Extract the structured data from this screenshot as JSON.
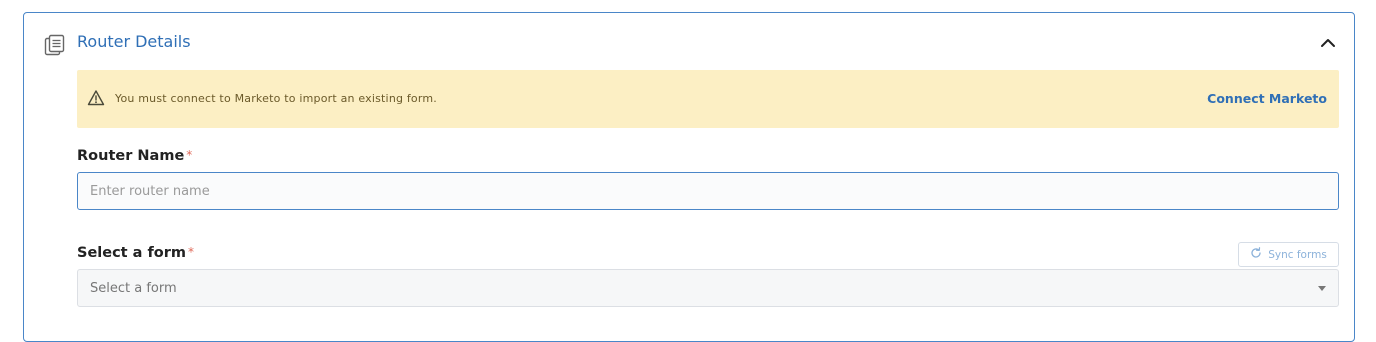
{
  "panel": {
    "title": "Router Details",
    "icon": "document-stack-icon",
    "collapse_icon": "chevron-up-icon"
  },
  "alert": {
    "icon": "warning-icon",
    "message": "You must connect to Marketo to import an existing form.",
    "link_label": "Connect Marketo"
  },
  "router_name": {
    "label": "Router Name",
    "required_marker": "*",
    "value": "",
    "placeholder": "Enter router name"
  },
  "form_select": {
    "label": "Select a form",
    "required_marker": "*",
    "selected": "Select a form",
    "sync_label": "Sync forms",
    "sync_icon": "refresh-icon"
  },
  "colors": {
    "accent": "#2f6fb6",
    "alert_bg": "#fcefc4",
    "required": "#e06a5a"
  }
}
